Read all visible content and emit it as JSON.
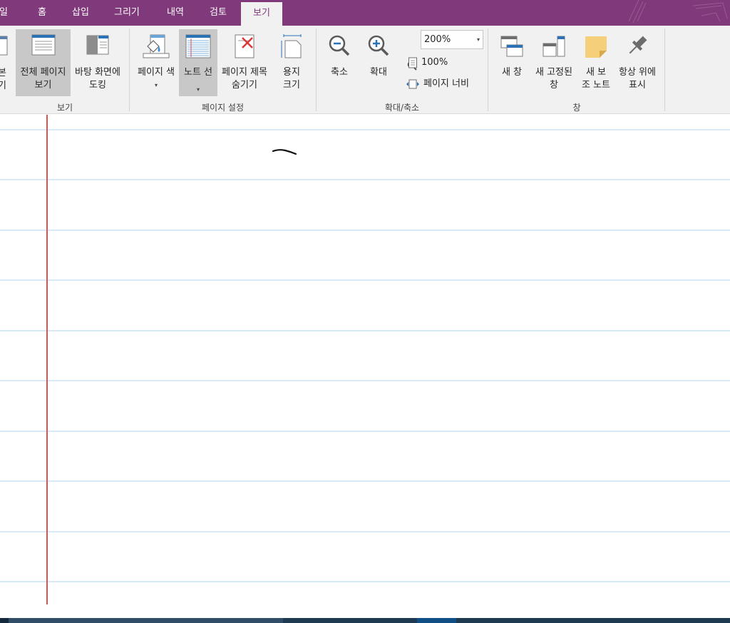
{
  "tabs": [
    {
      "label": "일",
      "active": false
    },
    {
      "label": "홈",
      "active": false
    },
    {
      "label": "삽입",
      "active": false
    },
    {
      "label": "그리기",
      "active": false
    },
    {
      "label": "내역",
      "active": false
    },
    {
      "label": "검토",
      "active": false
    },
    {
      "label": "보기",
      "active": true
    }
  ],
  "ribbon": {
    "view_group": {
      "label": "보기",
      "partial_button_line1": "본",
      "partial_button_line2": "기",
      "full_page_view_line1": "전체 페이지",
      "full_page_view_line2": "보기",
      "dock_desktop_line1": "바탕 화면에",
      "dock_desktop_line2": "도킹"
    },
    "page_setup_group": {
      "label": "페이지 설정",
      "page_color": "페이지 색",
      "rule_lines": "노트 선",
      "hide_title_line1": "페이지 제목",
      "hide_title_line2": "숨기기",
      "paper_size_line1": "용지",
      "paper_size_line2": "크기"
    },
    "zoom_group": {
      "label": "확대/축소",
      "zoom_out": "축소",
      "zoom_in": "확대",
      "zoom_value": "200%",
      "zoom_100": "100%",
      "page_width": "페이지 너비"
    },
    "window_group": {
      "label": "창",
      "new_window": "새 창",
      "new_docked_line1": "새 고정된",
      "new_docked_line2": "창",
      "new_side_note_line1": "새 보",
      "new_side_note_line2": "조 노트",
      "always_on_top_line1": "항상 위에",
      "always_on_top_line2": "표시"
    }
  },
  "colors": {
    "accent": "#80397b",
    "ribbon_bg": "#f1f1f1",
    "pressed": "#c8c8c8",
    "rule_line": "#d6ebf7",
    "margin_line": "#e0524c"
  },
  "icons": {
    "full_page_view": "full-page-view-icon",
    "dock": "dock-to-desktop-icon",
    "page_color": "page-color-icon",
    "rule_lines": "rule-lines-icon",
    "hide_title": "hide-page-title-icon",
    "paper_size": "paper-size-icon",
    "zoom_out": "zoom-out-icon",
    "zoom_in": "zoom-in-icon",
    "new_window": "new-window-icon",
    "new_docked": "new-docked-window-icon",
    "side_note": "side-note-icon",
    "pin": "pin-icon"
  }
}
